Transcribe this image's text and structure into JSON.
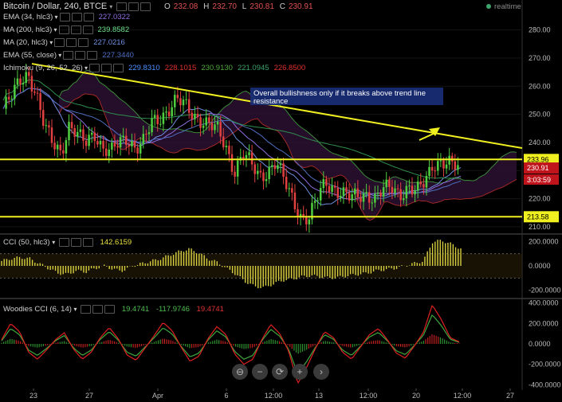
{
  "header": {
    "title": "Bitcoin / Dollar, 240, BTCE",
    "ohlc": {
      "o_label": "O",
      "o": "232.08",
      "h_label": "H",
      "h": "232.70",
      "l_label": "L",
      "l": "230.81",
      "c_label": "C",
      "c": "230.91"
    },
    "realtime": "realtime"
  },
  "legend": [
    {
      "name": "EMA (34, hlc3)",
      "values": [
        "227.0322"
      ],
      "colors": [
        "#8f6fe0"
      ]
    },
    {
      "name": "MA (200, hlc3)",
      "values": [
        "239.8582"
      ],
      "colors": [
        "#6de08c"
      ]
    },
    {
      "name": "MA (20, hlc3)",
      "values": [
        "227.0216"
      ],
      "colors": [
        "#6f8fe0"
      ]
    },
    {
      "name": "EMA (55, close)",
      "values": [
        "227.3440"
      ],
      "colors": [
        "#4f6fc0"
      ]
    },
    {
      "name": "Ichimoku (9, 26, 52, 26)",
      "values": [
        "229.8310",
        "228.1015",
        "230.9130",
        "221.0945",
        "226.8500"
      ],
      "colors": [
        "#4f8fff",
        "#e03030",
        "#4fa83a",
        "#3aa06a",
        "#e03030"
      ]
    }
  ],
  "annotation": "Overall bullishness only if it breaks above trend line resistance",
  "price_axis": {
    "ticks": [
      "280.00",
      "270.00",
      "260.00",
      "250.00",
      "240.00",
      "230.00",
      "220.00",
      "210.00"
    ],
    "tags": {
      "resistance": "233.96",
      "last": "230.91",
      "countdown": "3:03:59",
      "support": "213.58"
    }
  },
  "cci": {
    "label": "CCI (50, hlc3)",
    "value": "142.6159",
    "ticks": [
      "200.0000",
      "0.0000",
      "-200.0000"
    ]
  },
  "woodies": {
    "label": "Woodies CCI (6, 14)",
    "values": [
      "19.4741",
      "-117.9746",
      "19.4741"
    ],
    "ticks": [
      "400.0000",
      "200.0000",
      "0.0000",
      "-200.0000",
      "-400.0000"
    ]
  },
  "time_axis": [
    "23",
    "27",
    "Apr",
    "6",
    "12:00",
    "13",
    "12:00",
    "20",
    "12:00",
    "27"
  ],
  "nav": [
    "zoom-out",
    "minus",
    "reset",
    "plus",
    "forward"
  ],
  "chart_data": {
    "type": "candlestick",
    "symbol": "Bitcoin / Dollar",
    "interval": "240",
    "exchange": "BTCE",
    "ylim": [
      208,
      285
    ],
    "last_close": 230.91,
    "horizontal_levels": [
      233.96,
      213.58
    ],
    "trend_line": {
      "from": [
        0,
        268
      ],
      "to": [
        1,
        238
      ]
    },
    "price_path": [
      252,
      256,
      262,
      265,
      257,
      245,
      240,
      237,
      246,
      242,
      240,
      244,
      238,
      236,
      240,
      242,
      238,
      240,
      247,
      249,
      252,
      255,
      253,
      250,
      248,
      246,
      244,
      238,
      230,
      236,
      232,
      228,
      230,
      233,
      226,
      220,
      214,
      213,
      220,
      226,
      224,
      222,
      220,
      221,
      222,
      220,
      223,
      224,
      222,
      224,
      222,
      226,
      233,
      233,
      232,
      231
    ],
    "cci_path": [
      40,
      60,
      70,
      60,
      20,
      -20,
      -60,
      -70,
      -40,
      -50,
      -20,
      0,
      -30,
      -40,
      0,
      20,
      40,
      60,
      90,
      120,
      140,
      110,
      60,
      30,
      -20,
      -70,
      -130,
      -170,
      -180,
      -150,
      -120,
      -110,
      -90,
      -80,
      -90,
      -100,
      -95,
      -80,
      -70,
      -60,
      -40,
      -30,
      -20,
      0,
      20,
      40,
      200,
      210,
      180,
      142
    ],
    "woodies_path": [
      40,
      200,
      120,
      -80,
      -150,
      -60,
      40,
      110,
      -50,
      -150,
      -80,
      60,
      160,
      50,
      -110,
      -160,
      -40,
      80,
      210,
      130,
      -30,
      -170,
      -120,
      50,
      170,
      90,
      -100,
      -200,
      -150,
      40,
      190,
      100,
      -70,
      -390,
      -230,
      -40,
      120,
      60,
      -80,
      -150,
      -30,
      90,
      150,
      40,
      -90,
      -140,
      -20,
      110,
      380,
      240,
      60,
      20
    ],
    "cci_range": [
      -250,
      250
    ],
    "woodies_range": [
      -420,
      420
    ]
  }
}
